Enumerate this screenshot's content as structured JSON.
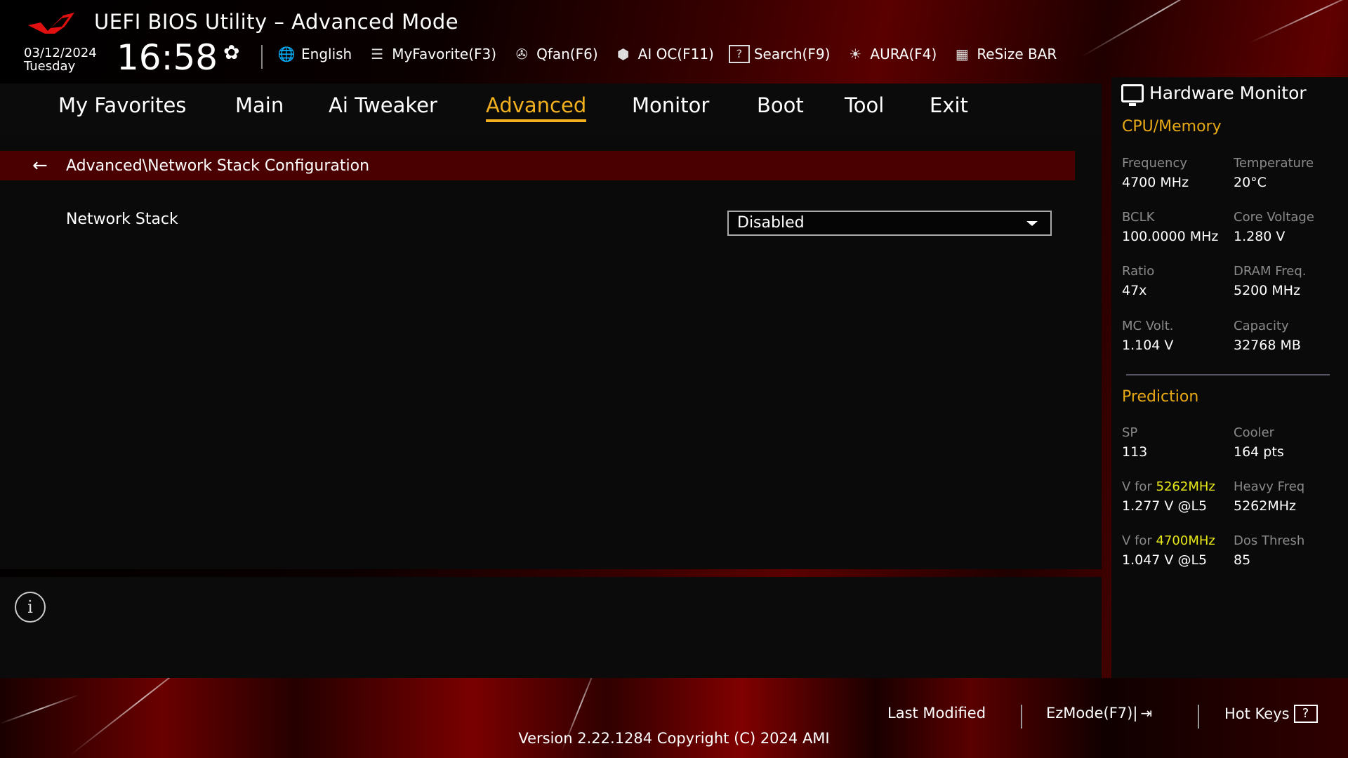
{
  "header": {
    "title": "UEFI BIOS Utility – Advanced Mode",
    "date": "03/12/2024",
    "day": "Tuesday",
    "time": "16:58",
    "toolbar": [
      {
        "icon": "globe-icon",
        "glyph": "🌐",
        "label": "English"
      },
      {
        "icon": "favorite-list-icon",
        "glyph": "☰",
        "label": "MyFavorite(F3)"
      },
      {
        "icon": "fan-icon",
        "glyph": "✇",
        "label": "Qfan(F6)"
      },
      {
        "icon": "ai-oc-icon",
        "glyph": "⬢",
        "label": "AI OC(F11)"
      },
      {
        "icon": "search-help-icon",
        "glyph": "?",
        "label": "Search(F9)"
      },
      {
        "icon": "aura-light-icon",
        "glyph": "☀",
        "label": "AURA(F4)"
      },
      {
        "icon": "resize-bar-icon",
        "glyph": "▦",
        "label": "ReSize BAR"
      }
    ]
  },
  "nav": {
    "tabs": [
      "My Favorites",
      "Main",
      "Ai Tweaker",
      "Advanced",
      "Monitor",
      "Boot",
      "Tool",
      "Exit"
    ],
    "active": "Advanced"
  },
  "main": {
    "breadcrumb": "Advanced\\Network Stack Configuration",
    "settings": [
      {
        "label": "Network Stack",
        "value": "Disabled"
      }
    ]
  },
  "hardware_monitor": {
    "title": "Hardware Monitor",
    "cpu_memory": {
      "heading": "CPU/Memory",
      "items": [
        {
          "label": "Frequency",
          "value": "4700 MHz"
        },
        {
          "label": "Temperature",
          "value": "20°C"
        },
        {
          "label": "BCLK",
          "value": "100.0000 MHz"
        },
        {
          "label": "Core Voltage",
          "value": "1.280 V"
        },
        {
          "label": "Ratio",
          "value": "47x"
        },
        {
          "label": "DRAM Freq.",
          "value": "5200 MHz"
        },
        {
          "label": "MC Volt.",
          "value": "1.104 V"
        },
        {
          "label": "Capacity",
          "value": "32768 MB"
        }
      ]
    },
    "prediction": {
      "heading": "Prediction",
      "sp_label": "SP",
      "sp_value": "113",
      "cooler_label": "Cooler",
      "cooler_value": "164 pts",
      "v1_prefix": "V for ",
      "v1_freq": "5262MHz",
      "v1_value": "1.277 V @L5",
      "heavy_label": "Heavy Freq",
      "heavy_value": "5262MHz",
      "v2_prefix": "V for ",
      "v2_freq": "4700MHz",
      "v2_value": "1.047 V @L5",
      "dos_label": "Dos Thresh",
      "dos_value": "85"
    }
  },
  "footer": {
    "last_modified": "Last Modified",
    "ezmode": "EzMode(F7)|",
    "hotkeys": "Hot Keys",
    "hotkeys_glyph": "?",
    "version": "Version 2.22.1284 Copyright (C) 2024 AMI"
  },
  "colors": {
    "accent": "#f2b01e",
    "breadcrumb_bg": "#4a0000",
    "highlight": "#e8e81a"
  }
}
